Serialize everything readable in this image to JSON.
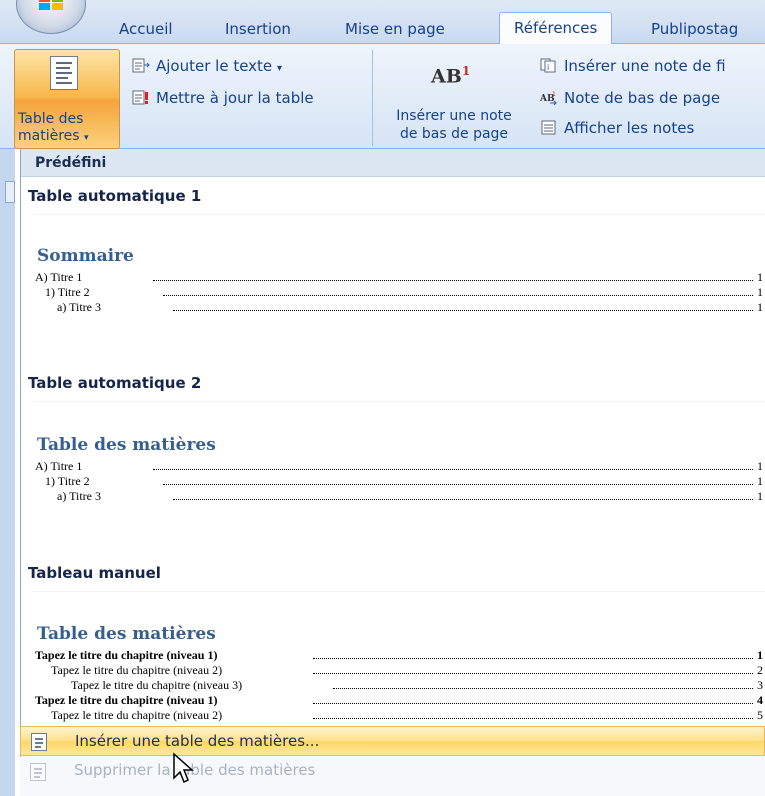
{
  "ribbon_tabs": [
    {
      "label": "Accueil"
    },
    {
      "label": "Insertion"
    },
    {
      "label": "Mise en page"
    },
    {
      "label": "Références"
    },
    {
      "label": "Publipostag"
    }
  ],
  "ribbon": {
    "toc_button_line1": "Table des",
    "toc_button_line2": "matières",
    "add_text": "Ajouter le texte",
    "update_table": "Mettre à jour la table",
    "ab_label": "AB",
    "ab_sup": "1",
    "insert_footnote_line1": "Insérer une note",
    "insert_footnote_line2": "de bas de page",
    "insert_endnote": "Insérer une note de fi",
    "next_footnote": "Note de bas de page",
    "show_notes": "Afficher les notes"
  },
  "gallery": {
    "header": "Prédéfini",
    "sections": [
      {
        "title": "Table automatique 1",
        "preview_title": "Sommaire",
        "lines": [
          {
            "text": "A)    Titre 1",
            "num": "1"
          },
          {
            "text": "1)    Titre 2",
            "num": "1"
          },
          {
            "text": "a)    Titre 3",
            "num": "1"
          }
        ]
      },
      {
        "title": "Table automatique 2",
        "preview_title": "Table des matières",
        "lines": [
          {
            "text": "A)    Titre 1",
            "num": "1"
          },
          {
            "text": "1)    Titre 2",
            "num": "1"
          },
          {
            "text": "a)    Titre 3",
            "num": "1"
          }
        ]
      },
      {
        "title": "Tableau manuel",
        "preview_title": "Table des matières",
        "lines": [
          {
            "text": "Tapez le titre du chapitre (niveau 1)",
            "num": "1"
          },
          {
            "text": "Tapez le titre du chapitre (niveau 2)",
            "num": "2"
          },
          {
            "text": "Tapez le titre du chapitre (niveau 3)",
            "num": "3"
          },
          {
            "text": "Tapez le titre du chapitre (niveau 1)",
            "num": "4"
          },
          {
            "text": "Tapez le titre du chapitre (niveau 2)",
            "num": "5"
          }
        ]
      }
    ]
  },
  "menu": {
    "insert_toc": "Insérer une table des matières...",
    "remove_toc": "Supprimer la table des matières"
  }
}
